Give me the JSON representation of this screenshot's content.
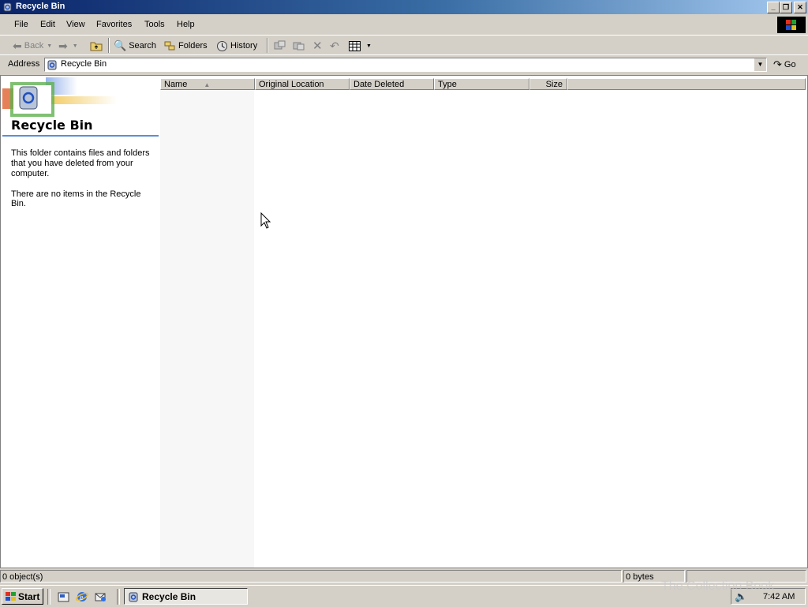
{
  "window": {
    "title": "Recycle Bin"
  },
  "menu": {
    "items": [
      "File",
      "Edit",
      "View",
      "Favorites",
      "Tools",
      "Help"
    ]
  },
  "toolbar": {
    "back": "Back",
    "search": "Search",
    "folders": "Folders",
    "history": "History"
  },
  "address": {
    "label": "Address",
    "value": "Recycle Bin",
    "go": "Go"
  },
  "left_pane": {
    "title": "Recycle Bin",
    "description": "This folder contains files and folders that you have deleted from your computer.",
    "empty_message": "There are no items in the Recycle Bin."
  },
  "list": {
    "columns": [
      "Name",
      "Original Location",
      "Date Deleted",
      "Type",
      "Size"
    ],
    "sort_indicator": "▲"
  },
  "status": {
    "objects": "0 object(s)",
    "size": "0 bytes"
  },
  "taskbar": {
    "start": "Start",
    "task": "Recycle Bin",
    "clock": "7:42 AM"
  },
  "watermark": "The Collection Book",
  "colors": {
    "title_start": "#0a246a",
    "title_end": "#a6caf0",
    "face": "#d4d0c8",
    "accent_rule": "#5b8ed6"
  }
}
